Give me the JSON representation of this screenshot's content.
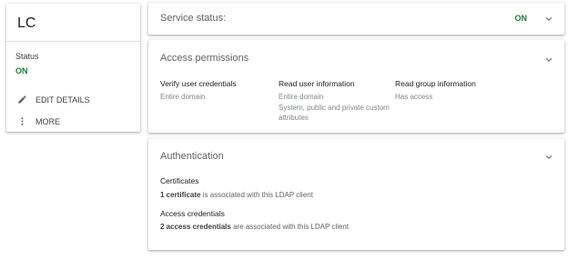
{
  "client": {
    "name": "LC",
    "status_label": "Status",
    "status_value": "ON",
    "actions": [
      {
        "label": "EDIT DETAILS",
        "icon": "pencil-icon"
      },
      {
        "label": "MORE",
        "icon": "more-vert-icon"
      }
    ]
  },
  "service_status": {
    "title": "Service status:",
    "value": "ON"
  },
  "access_permissions": {
    "title": "Access permissions",
    "columns": [
      {
        "header": "Verify user credentials",
        "lines": [
          "Entire domain"
        ]
      },
      {
        "header": "Read user information",
        "lines": [
          "Entire domain",
          "System, public and private custom attributes"
        ]
      },
      {
        "header": "Read group information",
        "lines": [
          "Has access"
        ]
      }
    ]
  },
  "authentication": {
    "title": "Authentication",
    "certificates": {
      "label": "Certificates",
      "count_text": "1 certificate",
      "rest_text": " is associated with this LDAP client"
    },
    "credentials": {
      "label": "Access credentials",
      "count_text": "2 access credentials",
      "rest_text": " are associated with this LDAP client"
    }
  },
  "colors": {
    "status_on": "#188038",
    "header_text": "#5f6368"
  }
}
